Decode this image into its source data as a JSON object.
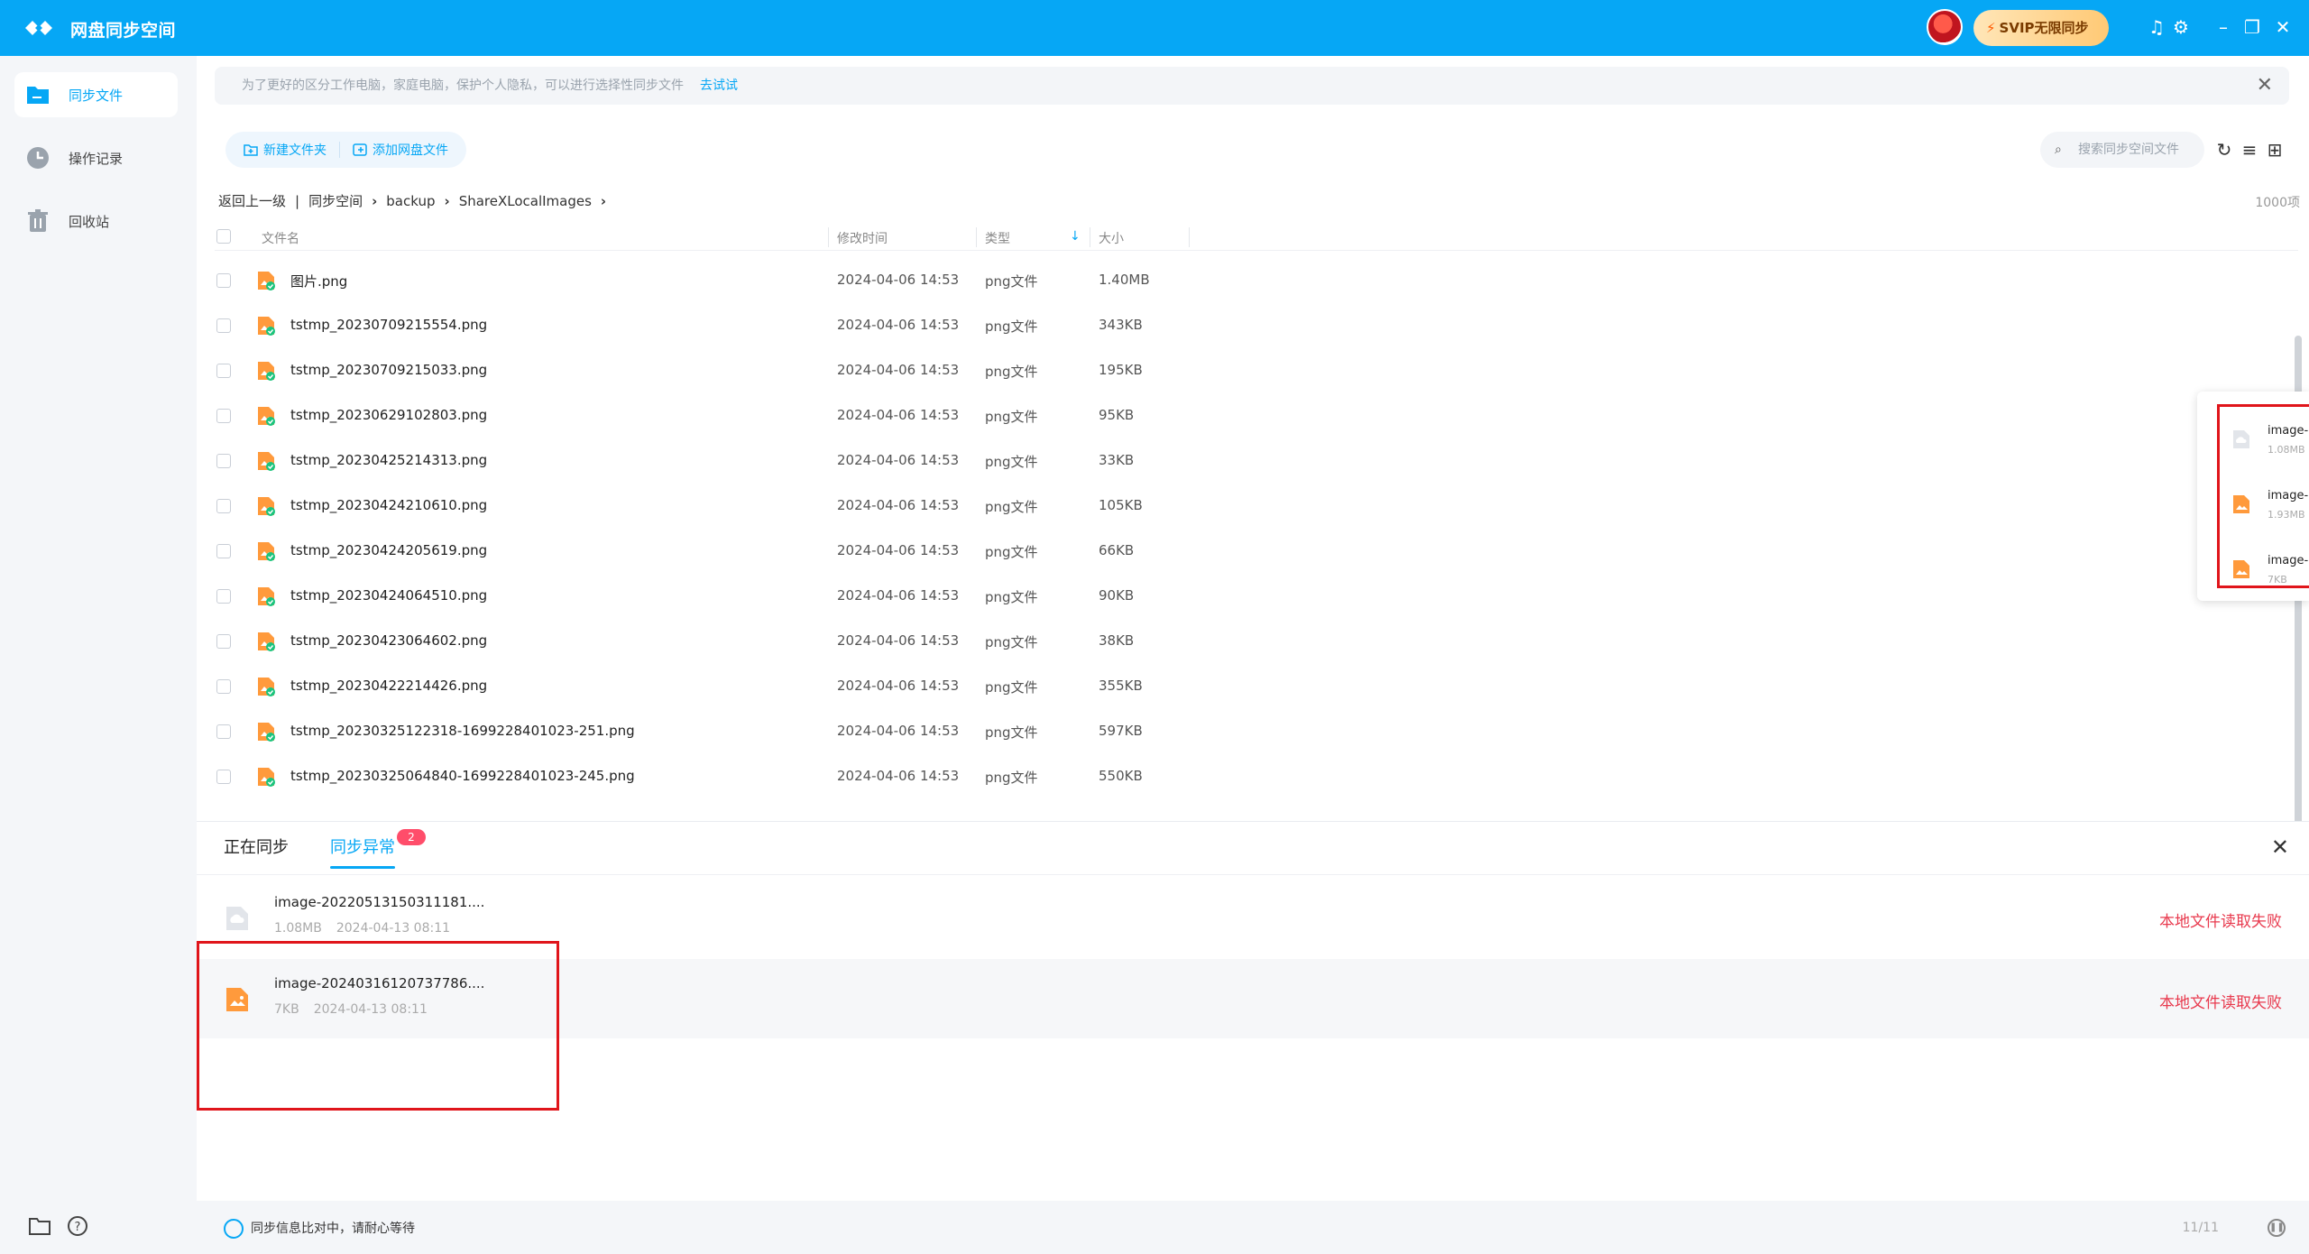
{
  "app": {
    "title": "网盘同步空间",
    "svip_label": "SVIP无限同步"
  },
  "sidebar": {
    "items": [
      {
        "label": "同步文件",
        "icon": "sync-folder-icon",
        "active": true
      },
      {
        "label": "操作记录",
        "icon": "clock-icon",
        "active": false
      },
      {
        "label": "回收站",
        "icon": "trash-icon",
        "active": false
      }
    ]
  },
  "banner": {
    "text": "为了更好的区分工作电脑，家庭电脑，保护个人隐私，可以进行选择性同步文件",
    "link": "去试试"
  },
  "toolbar": {
    "new_folder": "新建文件夹",
    "add_netdisk": "添加网盘文件"
  },
  "search": {
    "placeholder": "搜索同步空间文件"
  },
  "breadcrumb": {
    "back": "返回上一级",
    "sep": "|",
    "items": [
      "同步空间",
      "backup",
      "ShareXLocalImages"
    ]
  },
  "count_label": "1000项",
  "columns": {
    "name": "文件名",
    "mtime": "修改时间",
    "type": "类型",
    "size": "大小"
  },
  "files": [
    {
      "name": "图片.png",
      "mtime": "2024-04-06 14:53",
      "type": "png文件",
      "size": "1.40MB"
    },
    {
      "name": "tstmp_20230709215554.png",
      "mtime": "2024-04-06 14:53",
      "type": "png文件",
      "size": "343KB"
    },
    {
      "name": "tstmp_20230709215033.png",
      "mtime": "2024-04-06 14:53",
      "type": "png文件",
      "size": "195KB"
    },
    {
      "name": "tstmp_20230629102803.png",
      "mtime": "2024-04-06 14:53",
      "type": "png文件",
      "size": "95KB"
    },
    {
      "name": "tstmp_20230425214313.png",
      "mtime": "2024-04-06 14:53",
      "type": "png文件",
      "size": "33KB"
    },
    {
      "name": "tstmp_20230424210610.png",
      "mtime": "2024-04-06 14:53",
      "type": "png文件",
      "size": "105KB"
    },
    {
      "name": "tstmp_20230424205619.png",
      "mtime": "2024-04-06 14:53",
      "type": "png文件",
      "size": "66KB"
    },
    {
      "name": "tstmp_20230424064510.png",
      "mtime": "2024-04-06 14:53",
      "type": "png文件",
      "size": "90KB"
    },
    {
      "name": "tstmp_20230423064602.png",
      "mtime": "2024-04-06 14:53",
      "type": "png文件",
      "size": "38KB"
    },
    {
      "name": "tstmp_20230422214426.png",
      "mtime": "2024-04-06 14:53",
      "type": "png文件",
      "size": "355KB"
    },
    {
      "name": "tstmp_20230325122318-1699228401023-251.png",
      "mtime": "2024-04-06 14:53",
      "type": "png文件",
      "size": "597KB"
    },
    {
      "name": "tstmp_20230325064840-1699228401023-245.png",
      "mtime": "2024-04-06 14:53",
      "type": "png文件",
      "size": "550KB"
    }
  ],
  "popover": {
    "items": [
      {
        "name": "image-",
        "meta": "1.08MB",
        "icon": "cloud-file-icon"
      },
      {
        "name": "image-",
        "meta": "1.93MB",
        "icon": "image-file-icon"
      },
      {
        "name": "image-",
        "meta": "7KB",
        "icon": "image-file-icon"
      }
    ]
  },
  "panel": {
    "tab_syncing": "正在同步",
    "tab_errors": "同步异常",
    "error_count": "2",
    "errors": [
      {
        "name": "image-20220513150311181....",
        "size": "1.08MB",
        "time": "2024-04-13 08:11",
        "status": "本地文件读取失败",
        "icon": "cloud-file-icon"
      },
      {
        "name": "image-20240316120737786....",
        "size": "7KB",
        "time": "2024-04-13 08:11",
        "status": "本地文件读取失败",
        "icon": "image-file-icon"
      }
    ]
  },
  "status": {
    "text": "同步信息比对中，请耐心等待",
    "progress": "11/11"
  },
  "colors": {
    "accent": "#06a7f5",
    "error": "#e83a4e",
    "highlight": "#e0151b"
  }
}
